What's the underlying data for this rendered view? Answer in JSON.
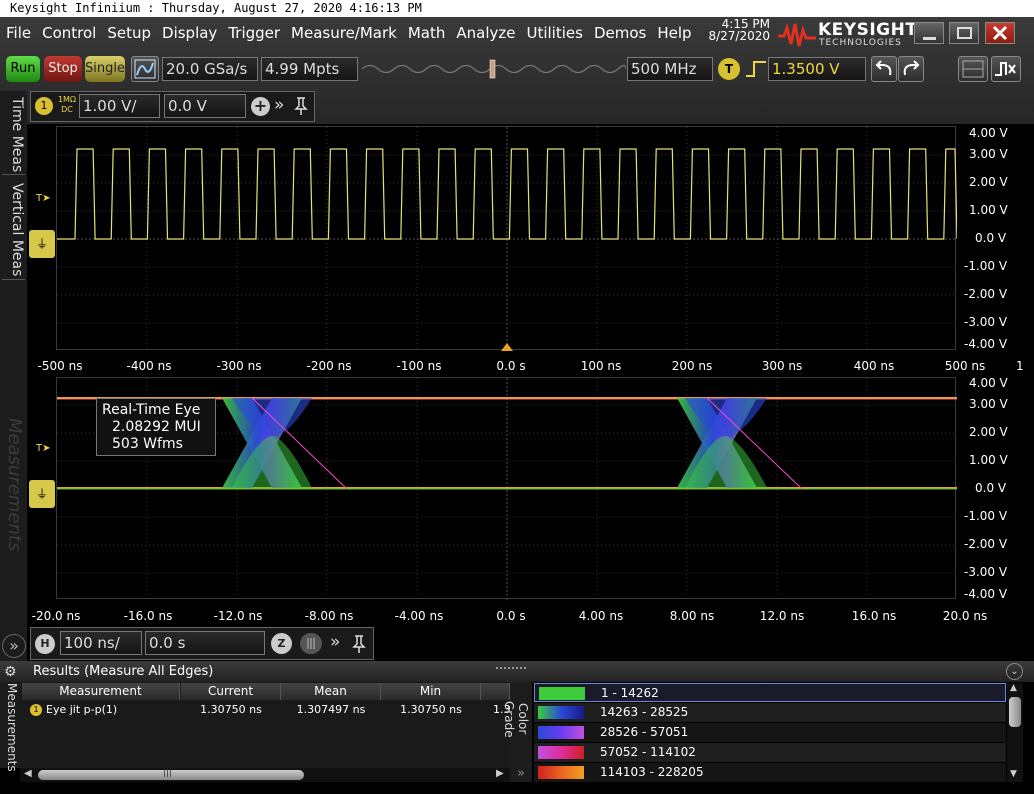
{
  "window": {
    "title": "Keysight Infiniium : Thursday, August 27, 2020 4:16:13 PM"
  },
  "menu": [
    "File",
    "Control",
    "Setup",
    "Display",
    "Trigger",
    "Measure/Mark",
    "Math",
    "Analyze",
    "Utilities",
    "Demos",
    "Help"
  ],
  "clock": {
    "time": "4:15 PM",
    "date": "8/27/2020"
  },
  "brand": {
    "name": "KEYSIGHT",
    "sub": "TECHNOLOGIES"
  },
  "toolbar": {
    "run": "Run",
    "stop": "Stop",
    "single": "Single",
    "sample_rate": "20.0 GSa/s",
    "memory_depth": "4.99 Mpts",
    "bandwidth": "500 MHz",
    "trigger_badge": "T",
    "trigger_level": "1.3500 V"
  },
  "channel": {
    "number": "1",
    "coupling_top": "1MΩ",
    "coupling_bottom": "DC",
    "scale": "1.00 V/",
    "offset": "0.0 V"
  },
  "sidebar": {
    "tab_time": "Time Meas",
    "tab_vertical": "Vertical Meas",
    "tab_measurements": "Measurements",
    "tab_bottom": "Measurements"
  },
  "markers": {
    "trigger": "T"
  },
  "top_grid": {
    "y_labels": [
      "4.00 V",
      "3.00 V",
      "2.00 V",
      "1.00 V",
      "0.0 V",
      "-1.00 V",
      "-2.00 V",
      "-3.00 V",
      "-4.00 V"
    ],
    "x_labels": [
      "-500 ns",
      "-400 ns",
      "-300 ns",
      "-200 ns",
      "-100 ns",
      "0.0 s",
      "100 ns",
      "200 ns",
      "300 ns",
      "400 ns",
      "500 ns"
    ],
    "edge_label": "1"
  },
  "eye_grid": {
    "y_labels": [
      "4.00 V",
      "3.00 V",
      "2.00 V",
      "1.00 V",
      "0.0 V",
      "-1.00 V",
      "-2.00 V",
      "-3.00 V",
      "-4.00 V"
    ],
    "x_labels": [
      "-20.0 ns",
      "-16.0 ns",
      "-12.0 ns",
      "-8.00 ns",
      "-4.00 ns",
      "0.0 s",
      "4.00 ns",
      "8.00 ns",
      "12.0 ns",
      "16.0 ns",
      "20.0 ns"
    ],
    "info_title": "Real-Time Eye",
    "info_ui": "2.08292 MUI",
    "info_wfms": "503 Wfms"
  },
  "horizontal": {
    "badge": "H",
    "scale": "100 ns/",
    "position": "0.0 s",
    "zoom_badge": "Z"
  },
  "results": {
    "title": "Results (Measure All Edges)",
    "side_label": "Measurements",
    "headers": [
      "Measurement",
      "Current",
      "Mean",
      "Min",
      ""
    ],
    "rows": [
      {
        "name": "Eye jit p-p(1)",
        "current": "1.30750 ns",
        "mean": "1.307497 ns",
        "min": "1.30750 ns",
        "extra": "1.3"
      }
    ]
  },
  "color_grade": {
    "label": "Color Grade",
    "ranges": [
      {
        "label": "1 - 14262",
        "color": "#3ccc3c"
      },
      {
        "label": "14263 - 28525",
        "color": "#2a4ad8"
      },
      {
        "label": "28526 - 57051",
        "color": "#6a3cf0"
      },
      {
        "label": "57052 - 114102",
        "color": "#e02c9c"
      },
      {
        "label": "114103 - 228205",
        "color": "#e86420"
      }
    ]
  },
  "colors": {
    "channel1": "#e8e07a",
    "accent": "#d8c84a"
  }
}
